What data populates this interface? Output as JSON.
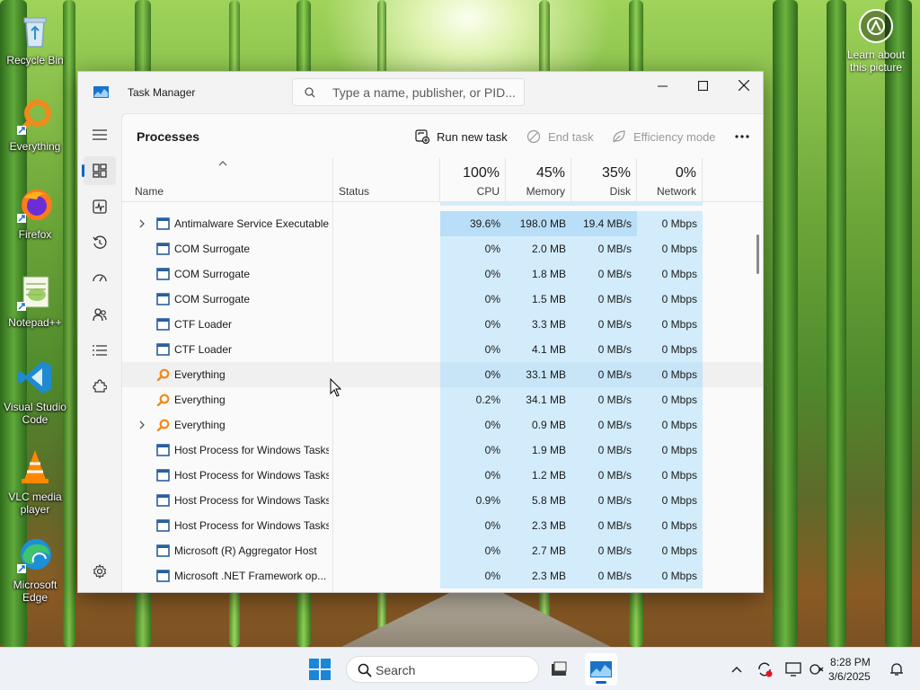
{
  "desktop": {
    "icons": [
      {
        "label": "Recycle Bin",
        "icon": "recycle-bin-icon"
      },
      {
        "label": "Everything",
        "icon": "everything-icon"
      },
      {
        "label": "Firefox",
        "icon": "firefox-icon"
      },
      {
        "label": "Notepad++",
        "icon": "notepadpp-icon"
      },
      {
        "label": "Visual Studio Code",
        "icon": "vscode-icon"
      },
      {
        "label": "VLC media player",
        "icon": "vlc-icon"
      },
      {
        "label": "Microsoft Edge",
        "icon": "edge-icon"
      }
    ],
    "learn_label": "Learn about this picture"
  },
  "window": {
    "title": "Task Manager",
    "search_placeholder": "Type a name, publisher, or PID...",
    "page_title": "Processes",
    "commands": {
      "run_new_task": "Run new task",
      "end_task": "End task",
      "efficiency_mode": "Efficiency mode"
    }
  },
  "nav": [
    "Processes",
    "Performance",
    "App history",
    "Startup apps",
    "Users",
    "Details",
    "Services",
    "Settings"
  ],
  "columns": {
    "name": "Name",
    "status": "Status",
    "cpu": {
      "pct": "100%",
      "label": "CPU"
    },
    "memory": {
      "pct": "45%",
      "label": "Memory"
    },
    "disk": {
      "pct": "35%",
      "label": "Disk"
    },
    "network": {
      "pct": "0%",
      "label": "Network"
    }
  },
  "processes": [
    {
      "name": "Antimalware Service Executable",
      "expandable": true,
      "icon": "app-frame-icon",
      "cpu": "39.6%",
      "memory": "198.0 MB",
      "disk": "19.4 MB/s",
      "network": "0 Mbps"
    },
    {
      "name": "COM Surrogate",
      "expandable": false,
      "icon": "app-frame-icon",
      "cpu": "0%",
      "memory": "2.0 MB",
      "disk": "0 MB/s",
      "network": "0 Mbps"
    },
    {
      "name": "COM Surrogate",
      "expandable": false,
      "icon": "app-frame-icon",
      "cpu": "0%",
      "memory": "1.8 MB",
      "disk": "0 MB/s",
      "network": "0 Mbps"
    },
    {
      "name": "COM Surrogate",
      "expandable": false,
      "icon": "app-frame-icon",
      "cpu": "0%",
      "memory": "1.5 MB",
      "disk": "0 MB/s",
      "network": "0 Mbps"
    },
    {
      "name": "CTF Loader",
      "expandable": false,
      "icon": "app-frame-icon",
      "cpu": "0%",
      "memory": "3.3 MB",
      "disk": "0 MB/s",
      "network": "0 Mbps"
    },
    {
      "name": "CTF Loader",
      "expandable": false,
      "icon": "app-frame-icon",
      "cpu": "0%",
      "memory": "4.1 MB",
      "disk": "0 MB/s",
      "network": "0 Mbps"
    },
    {
      "name": "Everything",
      "expandable": false,
      "icon": "everything-icon",
      "cpu": "0%",
      "memory": "33.1 MB",
      "disk": "0 MB/s",
      "network": "0 Mbps"
    },
    {
      "name": "Everything",
      "expandable": false,
      "icon": "everything-icon",
      "cpu": "0.2%",
      "memory": "34.1 MB",
      "disk": "0 MB/s",
      "network": "0 Mbps"
    },
    {
      "name": "Everything",
      "expandable": true,
      "icon": "everything-icon",
      "cpu": "0%",
      "memory": "0.9 MB",
      "disk": "0 MB/s",
      "network": "0 Mbps"
    },
    {
      "name": "Host Process for Windows Tasks",
      "expandable": false,
      "icon": "app-frame-icon",
      "cpu": "0%",
      "memory": "1.9 MB",
      "disk": "0 MB/s",
      "network": "0 Mbps"
    },
    {
      "name": "Host Process for Windows Tasks",
      "expandable": false,
      "icon": "app-frame-icon",
      "cpu": "0%",
      "memory": "1.2 MB",
      "disk": "0 MB/s",
      "network": "0 Mbps"
    },
    {
      "name": "Host Process for Windows Tasks",
      "expandable": false,
      "icon": "app-frame-icon",
      "cpu": "0.9%",
      "memory": "5.8 MB",
      "disk": "0 MB/s",
      "network": "0 Mbps"
    },
    {
      "name": "Host Process for Windows Tasks",
      "expandable": false,
      "icon": "app-frame-icon",
      "cpu": "0%",
      "memory": "2.3 MB",
      "disk": "0 MB/s",
      "network": "0 Mbps"
    },
    {
      "name": "Microsoft (R) Aggregator Host",
      "expandable": false,
      "icon": "app-frame-icon",
      "cpu": "0%",
      "memory": "2.7 MB",
      "disk": "0 MB/s",
      "network": "0 Mbps"
    },
    {
      "name": "Microsoft .NET Framework op...",
      "expandable": false,
      "icon": "app-frame-icon",
      "cpu": "0%",
      "memory": "2.3 MB",
      "disk": "0 MB/s",
      "network": "0 Mbps"
    }
  ],
  "taskbar": {
    "search_label": "Search",
    "time": "8:28 PM",
    "date": "3/6/2025"
  },
  "colors": {
    "accent": "#0067c0",
    "heat_cell": "#d3ecfb",
    "heat_cell_high": "#b9def7",
    "everything_orange": "#f08a1c"
  }
}
